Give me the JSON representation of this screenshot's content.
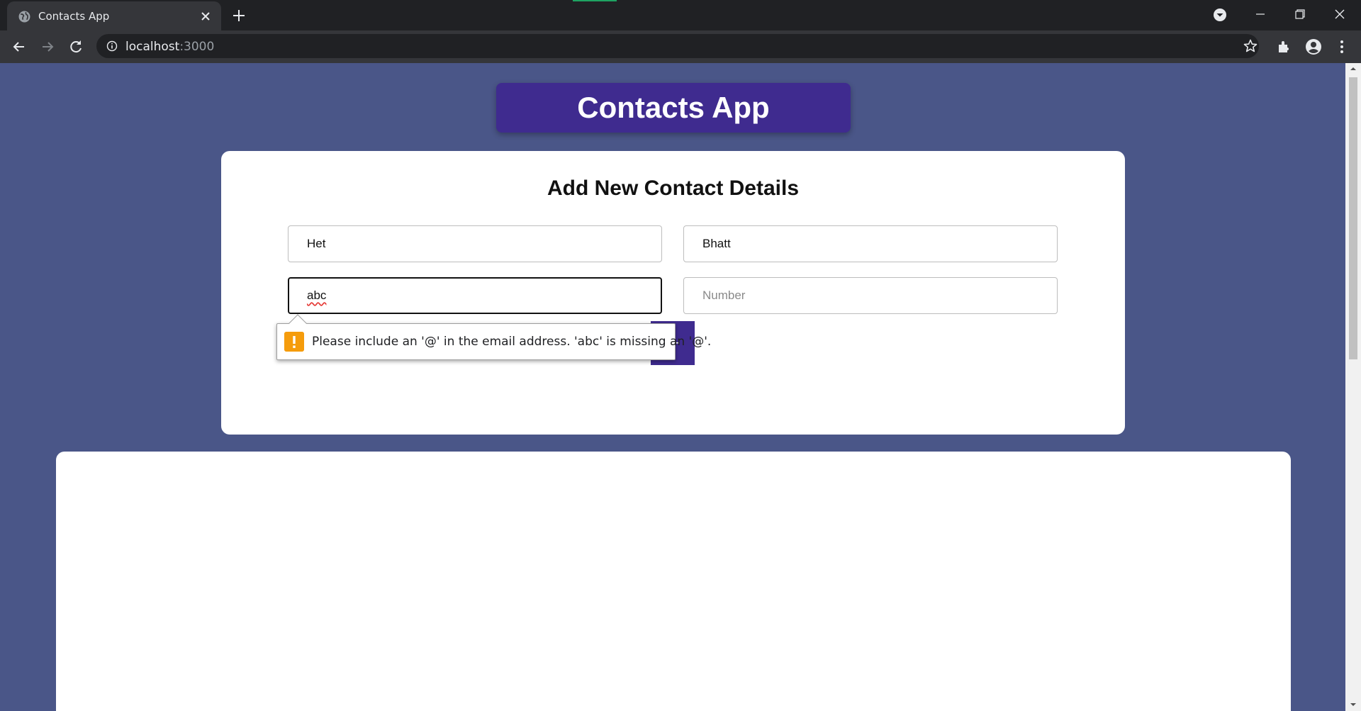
{
  "browser": {
    "tab_title": "Contacts App",
    "url_host": "localhost",
    "url_port": ":3000"
  },
  "page": {
    "app_title": "Contacts App",
    "form_title": "Add New Contact Details",
    "fields": {
      "first_name_value": "Het",
      "last_name_value": "Bhatt",
      "email_value": "abc",
      "number_placeholder": "Number"
    },
    "add_button_label": "+",
    "validation_message": "Please include an '@' in the email address. 'abc' is missing an '@'."
  },
  "colors": {
    "page_background": "#4a5688",
    "accent": "#3f2b8f",
    "warning": "#f59c0c"
  }
}
